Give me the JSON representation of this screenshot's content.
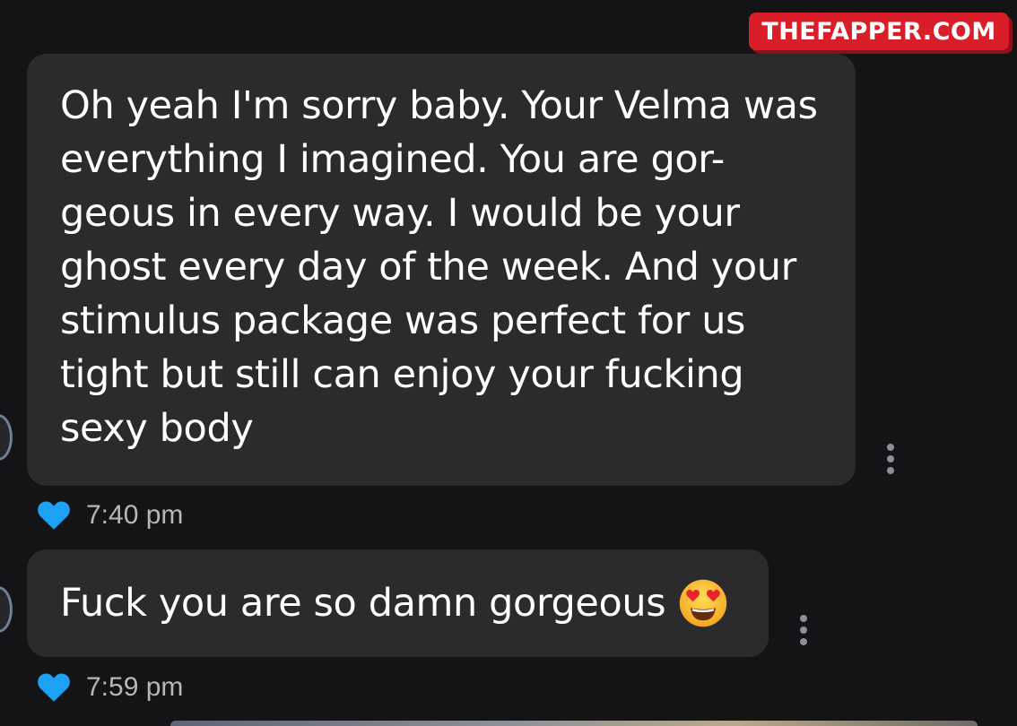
{
  "watermark": {
    "text": "THEFAPPER.COM"
  },
  "messages": [
    {
      "text": "Oh yeah I'm sorry baby. Your Velma was\neverything I imagined. You are gor-\ngeous in every way. I would be your\nghost every day of the week. And your\nstimulus package was perfect for us\ntight but still can enjoy your fucking\nsexy body",
      "time": "7:40 pm",
      "reaction": "heart"
    },
    {
      "text": "Fuck you are so damn gorgeous",
      "emoji": "heart-eyes-emoji",
      "time": "7:59 pm",
      "reaction": "heart"
    }
  ],
  "colors": {
    "background": "#141416",
    "bubble": "#2b2b2e",
    "heart": "#1da1f2",
    "watermark": "#d91e2a",
    "timestamp": "#b7b7ba"
  }
}
